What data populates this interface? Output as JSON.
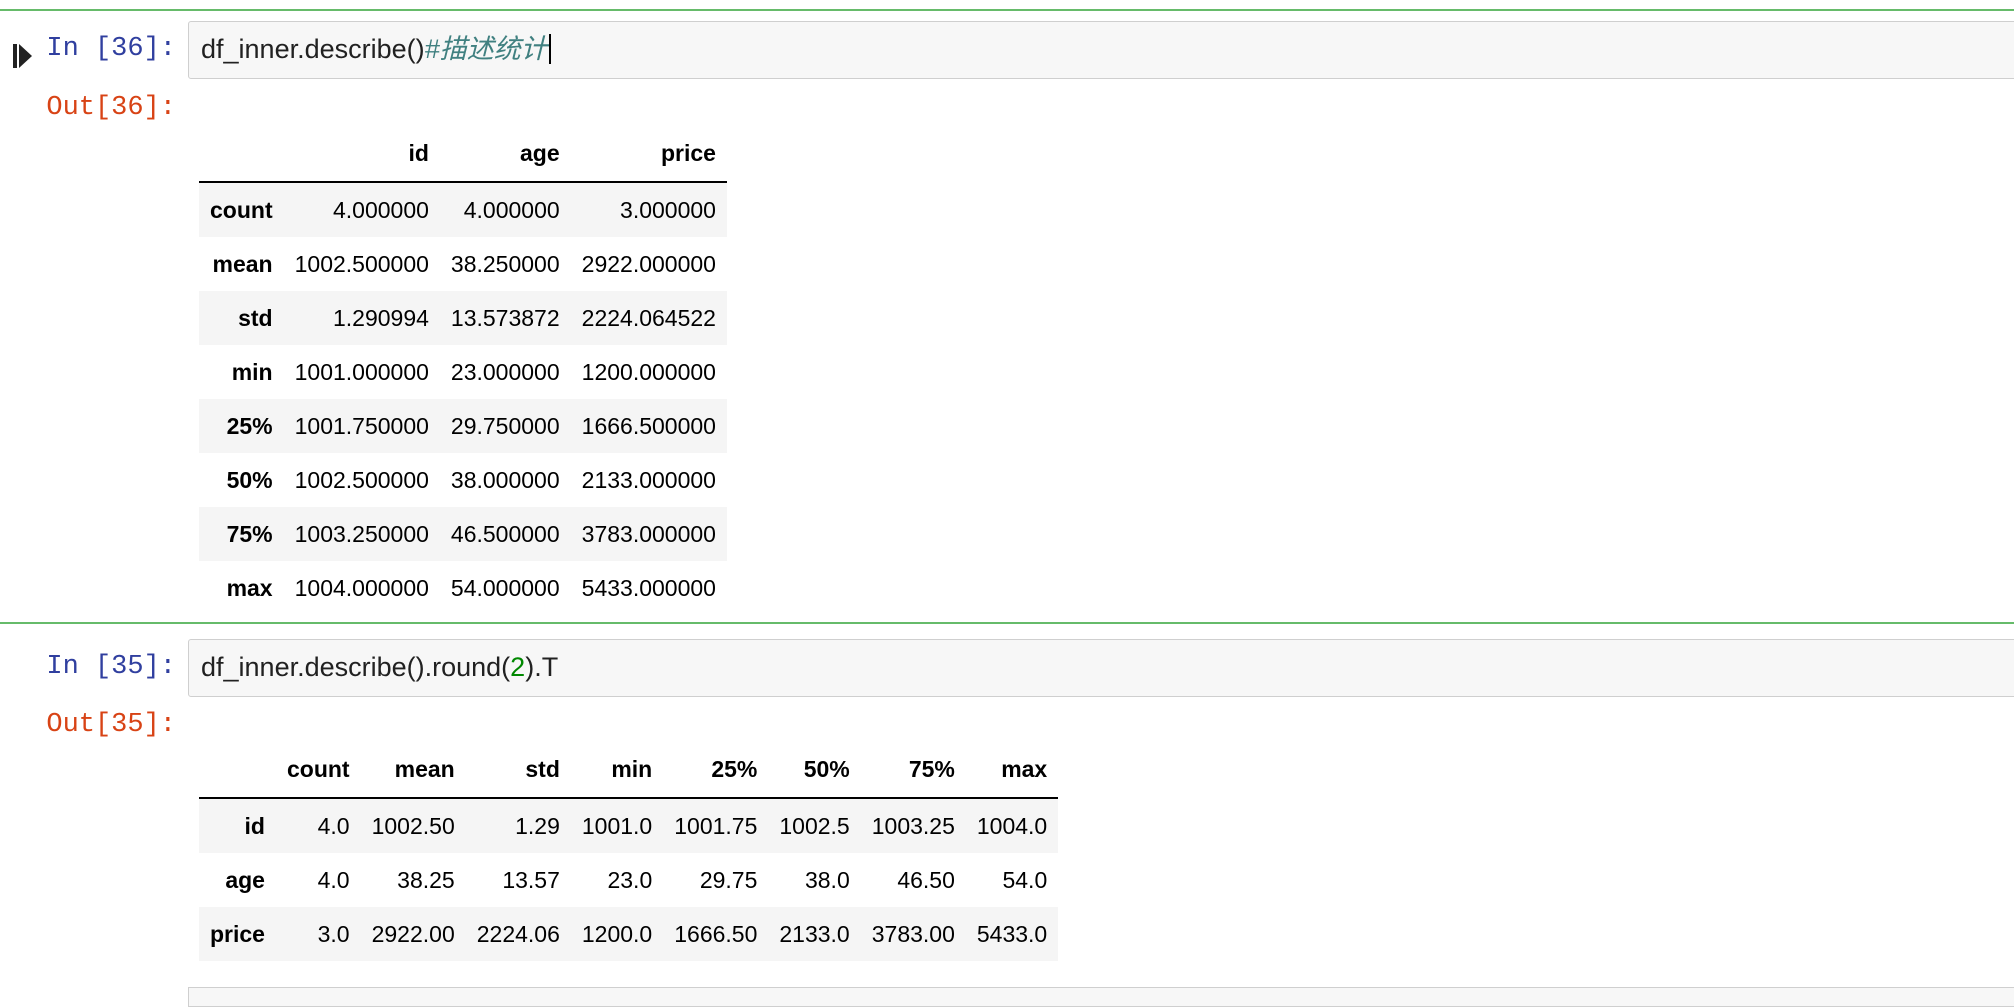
{
  "cells": [
    {
      "in_prompt": "In [36]:",
      "code": "df_inner.describe()",
      "comment": "#描述统计",
      "out_prompt": "Out[36]:",
      "table": {
        "columns": [
          "",
          "id",
          "age",
          "price"
        ],
        "rows": [
          {
            "label": "count",
            "values": [
              "4.000000",
              "4.000000",
              "3.000000"
            ]
          },
          {
            "label": "mean",
            "values": [
              "1002.500000",
              "38.250000",
              "2922.000000"
            ]
          },
          {
            "label": "std",
            "values": [
              "1.290994",
              "13.573872",
              "2224.064522"
            ]
          },
          {
            "label": "min",
            "values": [
              "1001.000000",
              "23.000000",
              "1200.000000"
            ]
          },
          {
            "label": "25%",
            "values": [
              "1001.750000",
              "29.750000",
              "1666.500000"
            ]
          },
          {
            "label": "50%",
            "values": [
              "1002.500000",
              "38.000000",
              "2133.000000"
            ]
          },
          {
            "label": "75%",
            "values": [
              "1003.250000",
              "46.500000",
              "3783.000000"
            ]
          },
          {
            "label": "max",
            "values": [
              "1004.000000",
              "54.000000",
              "5433.000000"
            ]
          }
        ]
      }
    },
    {
      "in_prompt": "In [35]:",
      "code_before": "df_inner.describe().round(",
      "code_num": "2",
      "code_after": ").T",
      "out_prompt": "Out[35]:",
      "table": {
        "columns": [
          "",
          "count",
          "mean",
          "std",
          "min",
          "25%",
          "50%",
          "75%",
          "max"
        ],
        "rows": [
          {
            "label": "id",
            "values": [
              "4.0",
              "1002.50",
              "1.29",
              "1001.0",
              "1001.75",
              "1002.5",
              "1003.25",
              "1004.0"
            ]
          },
          {
            "label": "age",
            "values": [
              "4.0",
              "38.25",
              "13.57",
              "23.0",
              "29.75",
              "38.0",
              "46.50",
              "54.0"
            ]
          },
          {
            "label": "price",
            "values": [
              "3.0",
              "2922.00",
              "2224.06",
              "1200.0",
              "1666.50",
              "2133.0",
              "3783.00",
              "5433.0"
            ]
          }
        ]
      }
    }
  ],
  "icons": {
    "run": "run-cell-icon"
  },
  "colors": {
    "selected_border": "#66bb6a",
    "in_prompt": "#303f9f",
    "out_prompt": "#d84315",
    "comment": "#408080",
    "number": "#008800"
  }
}
